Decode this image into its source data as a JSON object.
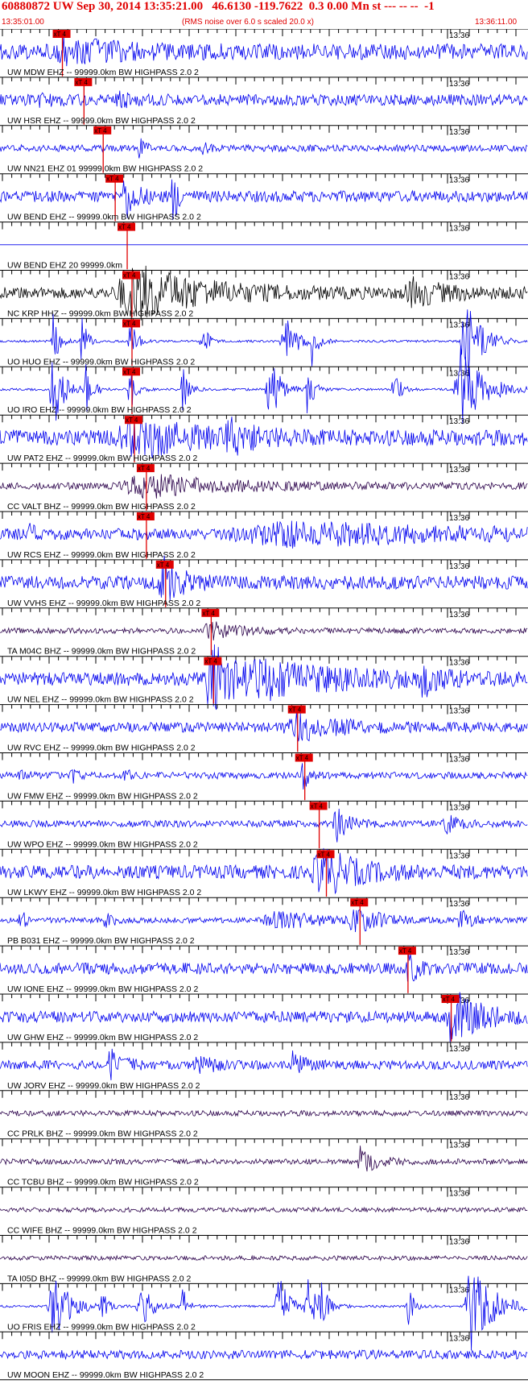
{
  "header": {
    "title": "60880872 UW Sep 30, 2014 13:35:21.00   46.6130 -119.7622  0.3 0.00 Mn st --- -- --  -1",
    "start_time": "13:35:01.00",
    "subtitle": "(RMS noise over 6.0 s scaled 20.0 x)",
    "end_time": "13:36:11.00"
  },
  "minute_label": "13:36",
  "pick_label": "xT 4",
  "colors": {
    "header": "#e00000",
    "pick": "#e00000",
    "blue": "#0000ee",
    "black": "#000000",
    "purple": "#2a004a"
  },
  "traces": [
    {
      "label": "UW MDW EHZ -- 99999.0km BW  HIGHPASS  2.0  2",
      "color": "blue",
      "amp": 0.35,
      "seed": 1,
      "pick": 13.0,
      "events": [
        [
          13,
          3,
          0.5
        ],
        [
          20,
          10,
          0.2
        ]
      ]
    },
    {
      "label": "UW HSR EHZ -- 99999.0km BW  HIGHPASS  2.0  2",
      "color": "blue",
      "amp": 0.25,
      "seed": 2,
      "pick": 17.5,
      "events": [
        [
          8,
          2,
          0.2
        ],
        [
          25,
          3,
          0.25
        ]
      ]
    },
    {
      "label": "UW NN21 EHZ 01 99999.0km BW  HIGHPASS  2.0  2",
      "color": "blue",
      "amp": 0.15,
      "seed": 3,
      "pick": 21.5,
      "events": [
        [
          29,
          1,
          0.6
        ],
        [
          42,
          1,
          0.3
        ]
      ]
    },
    {
      "label": "UW BEND EHZ -- 99999.0km BW  HIGHPASS  2.0  2",
      "color": "blue",
      "amp": 0.25,
      "seed": 4,
      "pick": 24.0,
      "events": [
        [
          26,
          2,
          1.0
        ],
        [
          36,
          1,
          1.2
        ]
      ]
    },
    {
      "label": "UW BEND EHZ 20 99999.0km",
      "color": "blue",
      "amp": 0.0,
      "seed": 5,
      "pick": 26.5,
      "events": []
    },
    {
      "label": "NC KRP HHZ -- 99999.0km BW  HIGHPASS  2.0  2",
      "color": "black",
      "amp": 0.25,
      "seed": 6,
      "pick": 27.5,
      "events": [
        [
          28,
          12,
          1.2
        ],
        [
          86,
          6,
          0.5
        ]
      ]
    },
    {
      "label": "UO HUO EHZ -- 99999.0km BW  HIGHPASS  2.0  2",
      "color": "blue",
      "amp": 0.05,
      "seed": 7,
      "pick": 27.5,
      "events": [
        [
          11,
          1,
          1.5
        ],
        [
          17,
          1,
          1.2
        ],
        [
          27,
          1,
          1.3
        ],
        [
          42,
          1,
          1.0
        ],
        [
          59,
          2,
          1.4
        ],
        [
          65,
          1,
          1.0
        ],
        [
          97,
          3,
          1.8
        ]
      ]
    },
    {
      "label": "UO IRO EHZ -- 99999.0km BW  HIGHPASS  2.0  2",
      "color": "blue",
      "amp": 0.05,
      "seed": 8,
      "pick": 27.5,
      "events": [
        [
          11,
          2,
          1.8
        ],
        [
          18,
          1,
          1.3
        ],
        [
          27,
          1,
          1.3
        ],
        [
          38,
          1,
          1.2
        ],
        [
          56,
          2,
          1.6
        ],
        [
          64,
          1,
          1.4
        ],
        [
          82,
          1,
          1.2
        ],
        [
          96,
          4,
          2.0
        ]
      ]
    },
    {
      "label": "UW PAT2 EHZ -- 99999.0km BW  HIGHPASS  2.0  2",
      "color": "blue",
      "amp": 0.35,
      "seed": 9,
      "pick": 28.0,
      "events": [
        [
          28,
          10,
          0.8
        ],
        [
          48,
          4,
          0.5
        ]
      ]
    },
    {
      "label": "CC VALT BHZ -- 99999.0km BW  HIGHPASS  2.0  2",
      "color": "purple",
      "amp": 0.15,
      "seed": 10,
      "pick": 30.5,
      "events": [
        [
          30,
          14,
          0.5
        ]
      ]
    },
    {
      "label": "UW RCS EHZ -- 99999.0km BW  HIGHPASS  2.0  2",
      "color": "blue",
      "amp": 0.25,
      "seed": 11,
      "pick": 30.5,
      "events": [
        [
          6,
          1,
          0.5
        ],
        [
          60,
          35,
          0.4
        ]
      ]
    },
    {
      "label": "UW VVHS EHZ -- 99999.0km BW  HIGHPASS  2.0  2",
      "color": "blue",
      "amp": 0.3,
      "seed": 12,
      "pick": 34.5,
      "events": [
        [
          34,
          3,
          1.0
        ]
      ]
    },
    {
      "label": "TA M04C BHZ -- 99999.0km BW  HIGHPASS  2.0  2",
      "color": "purple",
      "amp": 0.12,
      "seed": 13,
      "pick": 44.0,
      "events": [
        [
          44,
          6,
          0.35
        ]
      ]
    },
    {
      "label": "UW NEL EHZ -- 99999.0km BW  HIGHPASS  2.0  2",
      "color": "blue",
      "amp": 0.3,
      "seed": 14,
      "pick": 44.5,
      "events": [
        [
          44,
          4,
          1.8
        ],
        [
          56,
          16,
          0.6
        ],
        [
          88,
          3,
          0.6
        ]
      ]
    },
    {
      "label": "UW RVC EHZ -- 99999.0km BW  HIGHPASS  2.0  2",
      "color": "blue",
      "amp": 0.22,
      "seed": 15,
      "pick": 62.0,
      "events": [
        [
          62,
          8,
          0.5
        ]
      ]
    },
    {
      "label": "UW FMW EHZ -- 99999.0km BW  HIGHPASS  2.0  2",
      "color": "blue",
      "amp": 0.15,
      "seed": 16,
      "pick": 63.5,
      "events": [
        [
          4,
          1,
          0.3
        ],
        [
          15,
          1,
          0.4
        ],
        [
          26,
          1,
          0.3
        ],
        [
          63,
          1,
          0.7
        ]
      ]
    },
    {
      "label": "UW WPO EHZ -- 99999.0km BW  HIGHPASS  2.0  2",
      "color": "blue",
      "amp": 0.15,
      "seed": 17,
      "pick": 66.5,
      "events": [
        [
          70,
          2,
          0.8
        ],
        [
          93,
          2,
          0.4
        ]
      ]
    },
    {
      "label": "UW LKWY EHZ -- 99999.0km BW  HIGHPASS  2.0  2",
      "color": "blue",
      "amp": 0.3,
      "seed": 18,
      "pick": 68.0,
      "events": [
        [
          67,
          6,
          1.0
        ]
      ]
    },
    {
      "label": "PB B031 EHZ -- 99999.0km BW  HIGHPASS  2.0  2",
      "color": "blue",
      "amp": 0.12,
      "seed": 19,
      "pick": 75.0,
      "events": [
        [
          4,
          1,
          0.6
        ],
        [
          22,
          1,
          0.6
        ],
        [
          57,
          8,
          0.4
        ],
        [
          74,
          4,
          0.6
        ],
        [
          96,
          2,
          0.4
        ]
      ]
    },
    {
      "label": "UW IONE EHZ -- 99999.0km BW  HIGHPASS  2.0  2",
      "color": "blue",
      "amp": 0.25,
      "seed": 20,
      "pick": 85.0,
      "events": [
        [
          85,
          2,
          0.6
        ]
      ]
    },
    {
      "label": "UW GHW EHZ -- 99999.0km BW  HIGHPASS  2.0  2",
      "color": "blue",
      "amp": 0.25,
      "seed": 21,
      "pick": 94.0,
      "events": [
        [
          94,
          5,
          1.2
        ]
      ]
    },
    {
      "label": "UW JORV EHZ -- 99999.0km BW  HIGHPASS  2.0  2",
      "color": "blue",
      "amp": 0.2,
      "seed": 22,
      "pick": null,
      "events": [
        [
          23,
          2,
          0.8
        ],
        [
          41,
          2,
          0.6
        ],
        [
          61,
          2,
          0.5
        ]
      ]
    },
    {
      "label": "CC PRLK BHZ -- 99999.0km BW  HIGHPASS  2.0  2",
      "color": "purple",
      "amp": 0.12,
      "seed": 23,
      "pick": null,
      "events": []
    },
    {
      "label": "CC TCBU BHZ -- 99999.0km BW  HIGHPASS  2.0  2",
      "color": "purple",
      "amp": 0.12,
      "seed": 24,
      "pick": null,
      "events": [
        [
          75,
          3,
          0.6
        ]
      ]
    },
    {
      "label": "CC WIFE BHZ -- 99999.0km BW  HIGHPASS  2.0  2",
      "color": "purple",
      "amp": 0.1,
      "seed": 25,
      "pick": null,
      "events": []
    },
    {
      "label": "TA I05D BHZ -- 99999.0km BW  HIGHPASS  2.0  2",
      "color": "purple",
      "amp": 0.1,
      "seed": 26,
      "pick": null,
      "events": []
    },
    {
      "label": "UO FRIS EHZ -- 99999.0km BW  HIGHPASS  2.0  2",
      "color": "blue",
      "amp": 0.05,
      "seed": 27,
      "pick": null,
      "events": [
        [
          11,
          3,
          1.6
        ],
        [
          21,
          1,
          0.8
        ],
        [
          29,
          2,
          1.2
        ],
        [
          38,
          1,
          1.0
        ],
        [
          58,
          2,
          1.4
        ],
        [
          64,
          2,
          1.2
        ],
        [
          67,
          1,
          0.8
        ],
        [
          85,
          1,
          1.0
        ],
        [
          98,
          4,
          2.0
        ]
      ]
    },
    {
      "label": "UW MOON EHZ -- 99999.0km BW  HIGHPASS  2.0  2",
      "color": "blue",
      "amp": 0.2,
      "seed": 28,
      "pick": null,
      "events": []
    }
  ]
}
